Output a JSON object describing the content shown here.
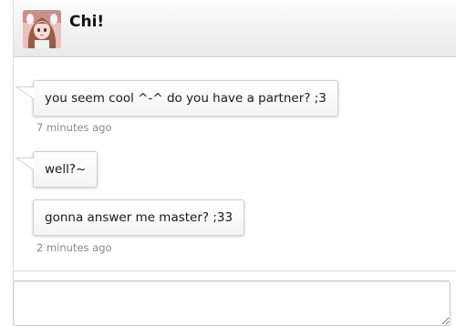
{
  "header": {
    "title": "Chi!"
  },
  "messages": [
    {
      "text": "you seem cool ^-^ do you have a partner? ;3"
    },
    {
      "text": "well?~"
    },
    {
      "text": "gonna answer me master? ;33"
    }
  ],
  "timestamps": [
    "7 minutes ago",
    "2 minutes ago"
  ],
  "reply_input": {
    "value": ""
  },
  "colors": {
    "bubble_border": "#cfcfcf",
    "timestamp": "#8a8a8a",
    "header_bg": "#eeeeee"
  }
}
